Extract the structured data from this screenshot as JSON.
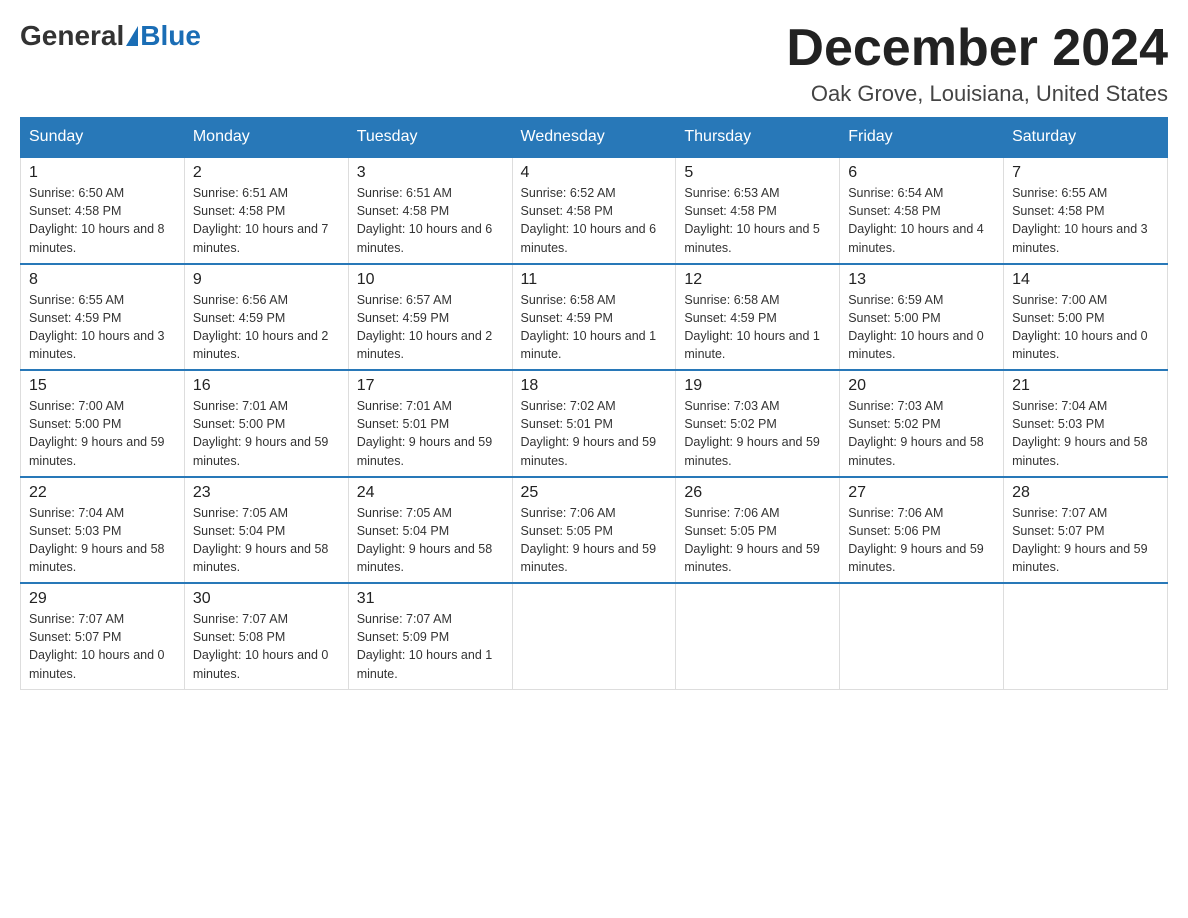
{
  "header": {
    "logo_general": "General",
    "logo_blue": "Blue",
    "month_title": "December 2024",
    "location": "Oak Grove, Louisiana, United States"
  },
  "weekdays": [
    "Sunday",
    "Monday",
    "Tuesday",
    "Wednesday",
    "Thursday",
    "Friday",
    "Saturday"
  ],
  "weeks": [
    [
      {
        "day": "1",
        "sunrise": "6:50 AM",
        "sunset": "4:58 PM",
        "daylight": "10 hours and 8 minutes."
      },
      {
        "day": "2",
        "sunrise": "6:51 AM",
        "sunset": "4:58 PM",
        "daylight": "10 hours and 7 minutes."
      },
      {
        "day": "3",
        "sunrise": "6:51 AM",
        "sunset": "4:58 PM",
        "daylight": "10 hours and 6 minutes."
      },
      {
        "day": "4",
        "sunrise": "6:52 AM",
        "sunset": "4:58 PM",
        "daylight": "10 hours and 6 minutes."
      },
      {
        "day": "5",
        "sunrise": "6:53 AM",
        "sunset": "4:58 PM",
        "daylight": "10 hours and 5 minutes."
      },
      {
        "day": "6",
        "sunrise": "6:54 AM",
        "sunset": "4:58 PM",
        "daylight": "10 hours and 4 minutes."
      },
      {
        "day": "7",
        "sunrise": "6:55 AM",
        "sunset": "4:58 PM",
        "daylight": "10 hours and 3 minutes."
      }
    ],
    [
      {
        "day": "8",
        "sunrise": "6:55 AM",
        "sunset": "4:59 PM",
        "daylight": "10 hours and 3 minutes."
      },
      {
        "day": "9",
        "sunrise": "6:56 AM",
        "sunset": "4:59 PM",
        "daylight": "10 hours and 2 minutes."
      },
      {
        "day": "10",
        "sunrise": "6:57 AM",
        "sunset": "4:59 PM",
        "daylight": "10 hours and 2 minutes."
      },
      {
        "day": "11",
        "sunrise": "6:58 AM",
        "sunset": "4:59 PM",
        "daylight": "10 hours and 1 minute."
      },
      {
        "day": "12",
        "sunrise": "6:58 AM",
        "sunset": "4:59 PM",
        "daylight": "10 hours and 1 minute."
      },
      {
        "day": "13",
        "sunrise": "6:59 AM",
        "sunset": "5:00 PM",
        "daylight": "10 hours and 0 minutes."
      },
      {
        "day": "14",
        "sunrise": "7:00 AM",
        "sunset": "5:00 PM",
        "daylight": "10 hours and 0 minutes."
      }
    ],
    [
      {
        "day": "15",
        "sunrise": "7:00 AM",
        "sunset": "5:00 PM",
        "daylight": "9 hours and 59 minutes."
      },
      {
        "day": "16",
        "sunrise": "7:01 AM",
        "sunset": "5:00 PM",
        "daylight": "9 hours and 59 minutes."
      },
      {
        "day": "17",
        "sunrise": "7:01 AM",
        "sunset": "5:01 PM",
        "daylight": "9 hours and 59 minutes."
      },
      {
        "day": "18",
        "sunrise": "7:02 AM",
        "sunset": "5:01 PM",
        "daylight": "9 hours and 59 minutes."
      },
      {
        "day": "19",
        "sunrise": "7:03 AM",
        "sunset": "5:02 PM",
        "daylight": "9 hours and 59 minutes."
      },
      {
        "day": "20",
        "sunrise": "7:03 AM",
        "sunset": "5:02 PM",
        "daylight": "9 hours and 58 minutes."
      },
      {
        "day": "21",
        "sunrise": "7:04 AM",
        "sunset": "5:03 PM",
        "daylight": "9 hours and 58 minutes."
      }
    ],
    [
      {
        "day": "22",
        "sunrise": "7:04 AM",
        "sunset": "5:03 PM",
        "daylight": "9 hours and 58 minutes."
      },
      {
        "day": "23",
        "sunrise": "7:05 AM",
        "sunset": "5:04 PM",
        "daylight": "9 hours and 58 minutes."
      },
      {
        "day": "24",
        "sunrise": "7:05 AM",
        "sunset": "5:04 PM",
        "daylight": "9 hours and 58 minutes."
      },
      {
        "day": "25",
        "sunrise": "7:06 AM",
        "sunset": "5:05 PM",
        "daylight": "9 hours and 59 minutes."
      },
      {
        "day": "26",
        "sunrise": "7:06 AM",
        "sunset": "5:05 PM",
        "daylight": "9 hours and 59 minutes."
      },
      {
        "day": "27",
        "sunrise": "7:06 AM",
        "sunset": "5:06 PM",
        "daylight": "9 hours and 59 minutes."
      },
      {
        "day": "28",
        "sunrise": "7:07 AM",
        "sunset": "5:07 PM",
        "daylight": "9 hours and 59 minutes."
      }
    ],
    [
      {
        "day": "29",
        "sunrise": "7:07 AM",
        "sunset": "5:07 PM",
        "daylight": "10 hours and 0 minutes."
      },
      {
        "day": "30",
        "sunrise": "7:07 AM",
        "sunset": "5:08 PM",
        "daylight": "10 hours and 0 minutes."
      },
      {
        "day": "31",
        "sunrise": "7:07 AM",
        "sunset": "5:09 PM",
        "daylight": "10 hours and 1 minute."
      },
      null,
      null,
      null,
      null
    ]
  ]
}
